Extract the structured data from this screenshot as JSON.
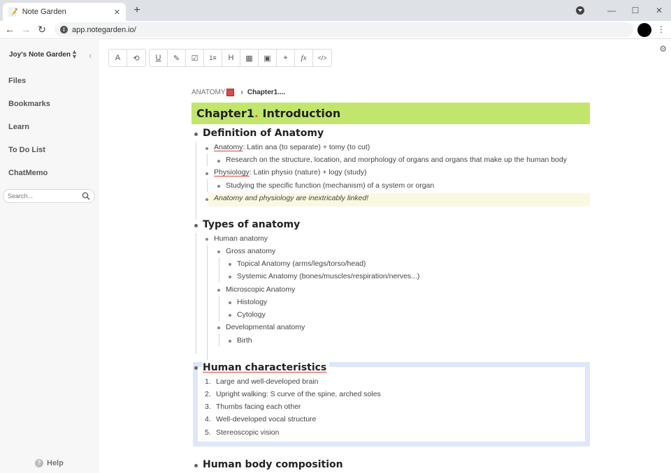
{
  "browser": {
    "tab_title": "Note Garden",
    "tab_favicon": "📝",
    "url": "app.notegarden.io/"
  },
  "sidebar": {
    "workspace": "Joy's Note Garden",
    "items": [
      {
        "label": "Files"
      },
      {
        "label": "Bookmarks"
      },
      {
        "label": "Learn"
      },
      {
        "label": "To Do List"
      },
      {
        "label": "ChatMemo"
      }
    ],
    "search_placeholder": "Search...",
    "help": "Help"
  },
  "toolbar": {
    "group1": [
      "A",
      "⟲"
    ],
    "group2": [
      "U",
      "✎",
      "☑",
      "1≡",
      "H",
      "▦",
      "▣",
      "⌖",
      "fx",
      "</>"
    ]
  },
  "breadcrumb": {
    "root": "ANATOMY",
    "current": "Chapter1...."
  },
  "chapter": {
    "prefix": "Chapter1",
    "dot": ".",
    "title": " Introduction"
  },
  "sections": {
    "definition": {
      "heading": "Definition of Anatomy",
      "anatomy_term": "Anatomy",
      "anatomy_rest": ": Latin ana (to separate) + tomy (to cut)",
      "anatomy_sub": "Research on the structure, location, and morphology of organs and organs that make up the human body",
      "physiology_term": "Physiology",
      "physiology_rest": ": Latin physio (nature) + logy (study)",
      "physiology_sub": "Studying the specific function (mechanism) of a system or organ",
      "note": "Anatomy and physiology are inextricably linked!",
      "note_suffix": "!"
    },
    "types": {
      "heading": "Types of anatomy",
      "human": "Human anatomy",
      "gross": "Gross anatomy",
      "topical": "Topical Anatomy (arms/legs/torso/head)",
      "systemic": "Systemic Anatomy (bones/muscles/respiration/nerves...)",
      "microscopic": "Microscopic Anatomy",
      "histology": "Histology",
      "cytology": "Cytology",
      "developmental": "Developmental anatomy",
      "birth": "Birth"
    },
    "characteristics": {
      "heading": "Human characteristics",
      "items": [
        {
          "num": "1.",
          "text": "Large and well-developed brain"
        },
        {
          "num": "2.",
          "text": "Upright walking: S curve of the spine, arched soles"
        },
        {
          "num": "3.",
          "text": "Thumbs facing each other"
        },
        {
          "num": "4.",
          "text": "Well-developed vocal structure"
        },
        {
          "num": "5.",
          "text": "Stereoscopic vision"
        }
      ]
    },
    "composition": {
      "heading": "Human body composition"
    }
  },
  "colors": {
    "chapter_bg": "#c2e66c",
    "chapter_accent": "#d46a2a",
    "highlight_bg": "#fbf8e0",
    "box_border": "#dde6fb",
    "underline_red": "#d9423a"
  }
}
